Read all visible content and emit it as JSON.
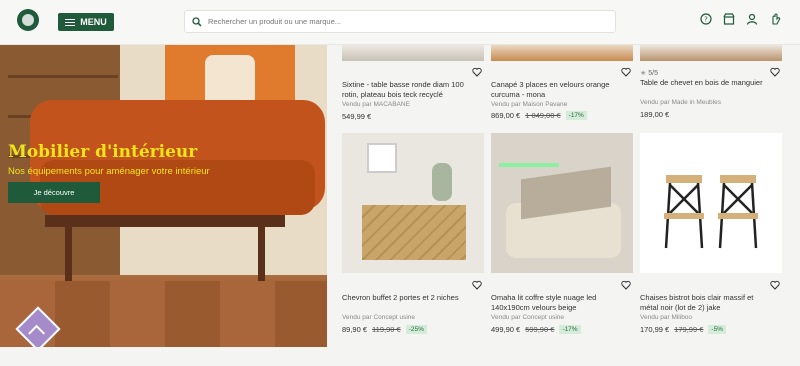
{
  "header": {
    "menu_label": "MENU",
    "search_placeholder": "Rechercher un produit ou une marque...",
    "icons": [
      "help-icon",
      "store-icon",
      "user-icon",
      "hand-icon"
    ]
  },
  "hero": {
    "title": "Mobilier d'intérieur",
    "subtitle": "Nos équipements pour aménager votre intérieur",
    "cta_label": "Je découvre"
  },
  "products": [
    {
      "name": "Sixtine - table basse ronde diam 100 rotin, plateau bois teck recyclé",
      "seller": "Vendu par MACABANE",
      "price": "549,99 €",
      "old_price": "",
      "discount": "",
      "rating": ""
    },
    {
      "name": "Canapé 3 places en velours orange curcuma - mona",
      "seller": "Vendu par Maison Pavane",
      "price": "869,00 €",
      "old_price": "1 049,00 €",
      "discount": "-17%",
      "rating": ""
    },
    {
      "name": "Table de chevet en bois de manguier",
      "seller": "Vendu par Made in Meubles",
      "price": "189,00 €",
      "old_price": "",
      "discount": "",
      "rating": "5/5"
    },
    {
      "name": "Chevron buffet 2 portes et 2 niches",
      "seller": "Vendu par Concept usine",
      "price": "89,90 €",
      "old_price": "119,90 €",
      "discount": "-25%",
      "rating": ""
    },
    {
      "name": "Omaha lit coffre style nuage led 140x190cm velours beige",
      "seller": "Vendu par Concept usine",
      "price": "499,90 €",
      "old_price": "599,90 €",
      "discount": "-17%",
      "rating": ""
    },
    {
      "name": "Chaises bistrot bois clair massif et métal noir (lot de 2) jake",
      "seller": "Vendu par Miliboo",
      "price": "170,99 €",
      "old_price": "179,99 €",
      "discount": "-5%",
      "rating": ""
    }
  ],
  "colors": {
    "brand_green": "#1f5a3a",
    "hero_yellow": "#f1e519",
    "badge_bg": "#d4ecd9",
    "scroll_purple": "#a58bc9"
  }
}
